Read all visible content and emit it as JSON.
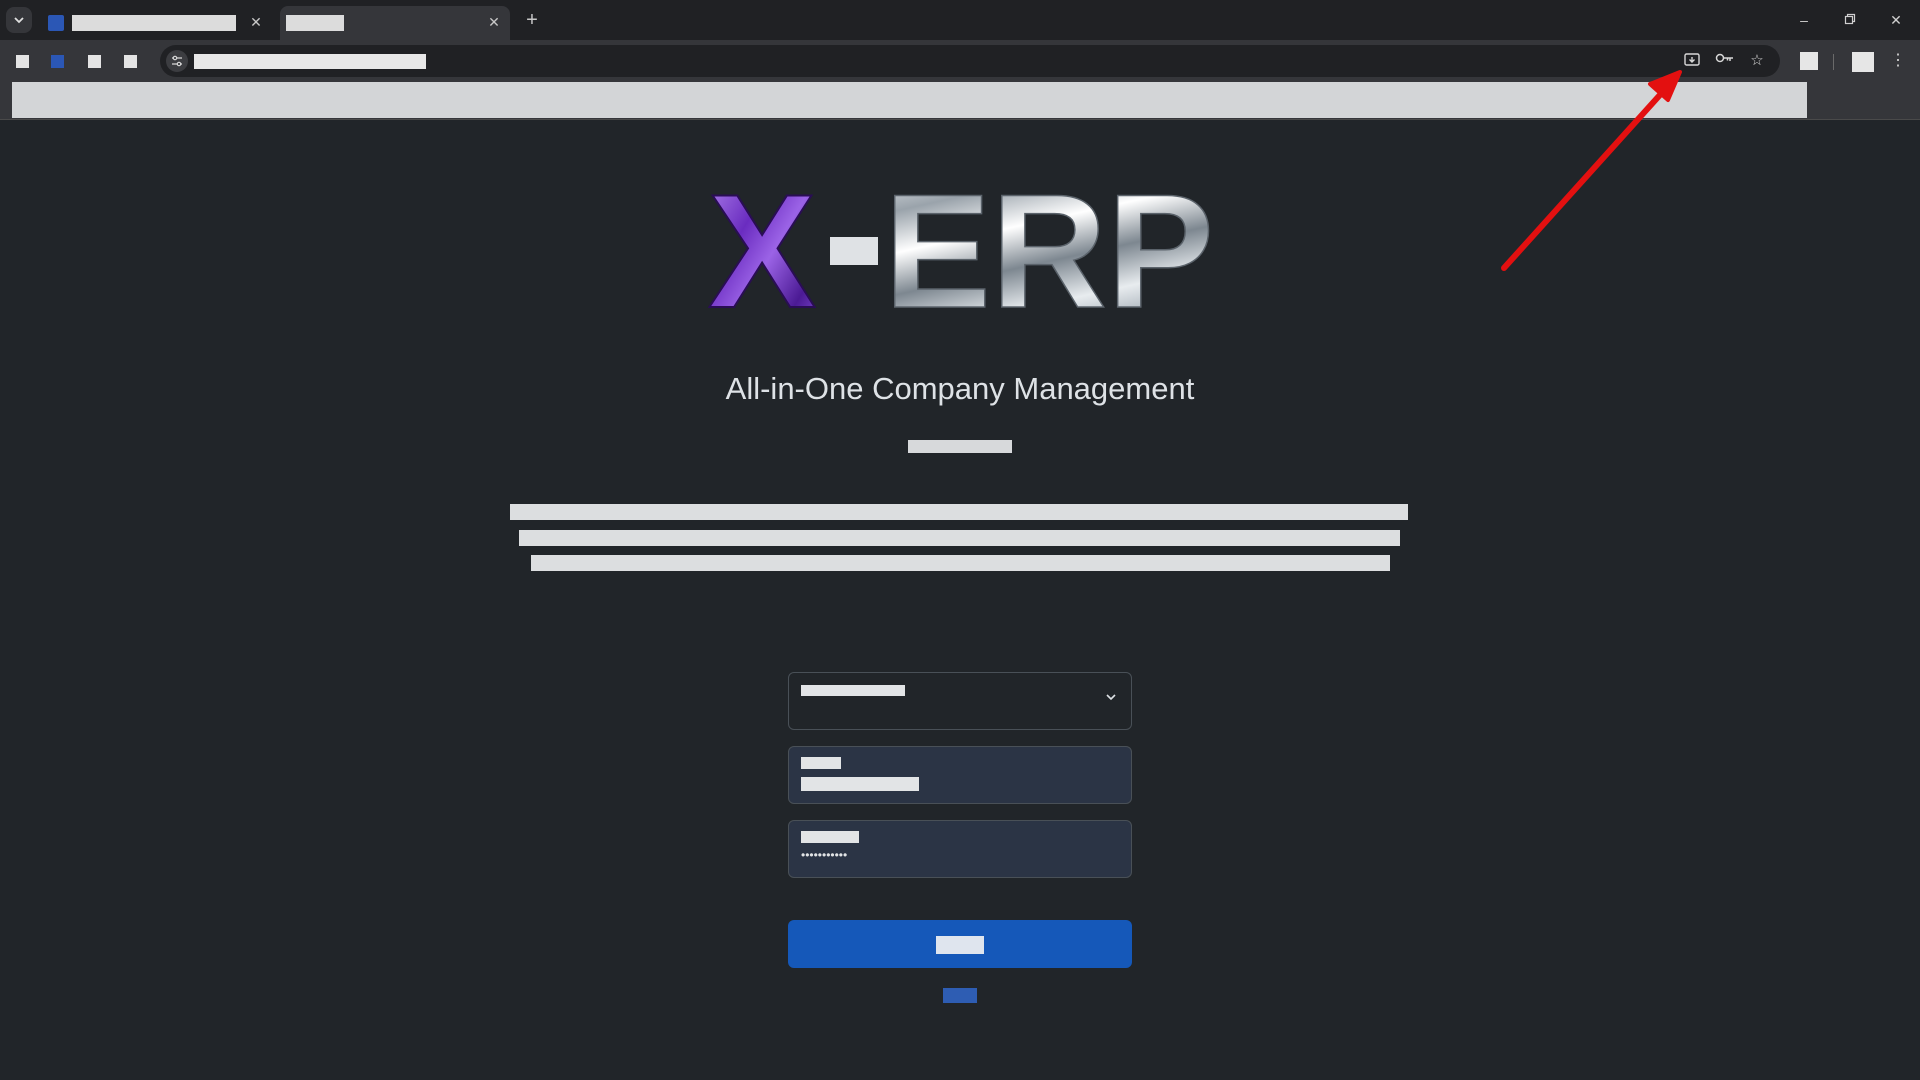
{
  "page": {
    "tagline": "All-in-One Company Management",
    "password_mask": "•••••••••••"
  },
  "logo": {
    "text_left": "X",
    "text_right": "ERP"
  },
  "icons": {
    "tab_search": "chevron-down-icon",
    "tab_close": "close-icon",
    "new_tab": "plus-icon",
    "site_info": "tune-icon",
    "cast": "cast-icon",
    "password_key": "key-icon",
    "bookmark_star": "star-icon",
    "select_chevron": "chevron-down-icon"
  },
  "colors": {
    "page_bg": "#212529",
    "primary_button": "#1558b9",
    "annotation_arrow": "#e31010",
    "logo_purple": "#7a3fd0"
  }
}
